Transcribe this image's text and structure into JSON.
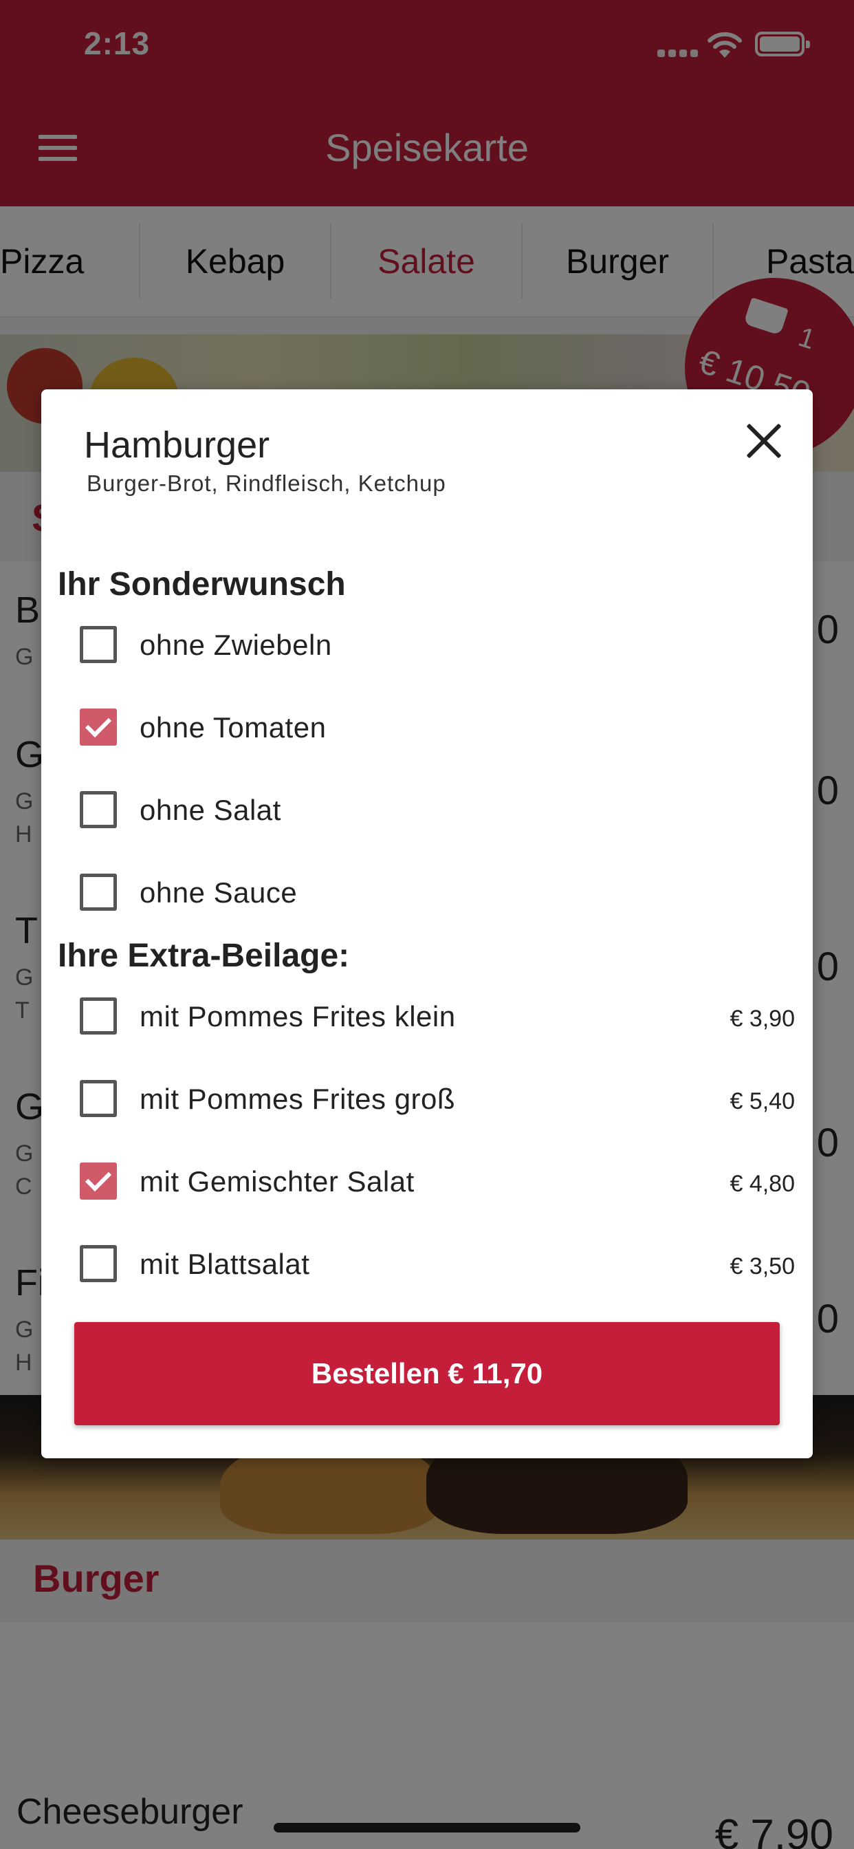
{
  "status_bar": {
    "time": "2:13"
  },
  "header": {
    "title": "Speisekarte"
  },
  "tabs": [
    {
      "label": "Pizza"
    },
    {
      "label": "Kebap"
    },
    {
      "label": "Salate",
      "active": true
    },
    {
      "label": "Burger"
    },
    {
      "label": "Pasta"
    }
  ],
  "cart": {
    "count": "1",
    "total": "€ 10,50"
  },
  "background_list": {
    "section_letter": "S",
    "items": [
      {
        "name": "B",
        "sub": "G",
        "price": "0"
      },
      {
        "name": "G",
        "sub": "G",
        "sub2": "H",
        "price": "0"
      },
      {
        "name": "T",
        "sub": "G",
        "sub2": "T",
        "price": "0"
      },
      {
        "name": "G",
        "sub": "G",
        "sub2": "C",
        "price": "0"
      },
      {
        "name": "Fi",
        "sub": "G",
        "sub2": "H",
        "price": "0"
      }
    ],
    "burger_section_title": "Burger",
    "cheese_item": {
      "name": "Cheeseburger",
      "price": "€ 7,90"
    }
  },
  "modal": {
    "title": "Hamburger",
    "subtitle": "Burger-Brot, Rindfleisch, Ketchup",
    "special_section": "Ihr Sonderwunsch",
    "special_options": [
      {
        "label": "ohne Zwiebeln",
        "checked": false
      },
      {
        "label": "ohne Tomaten",
        "checked": true
      },
      {
        "label": "ohne Salat",
        "checked": false
      },
      {
        "label": "ohne Sauce",
        "checked": false
      }
    ],
    "extra_section": "Ihre Extra-Beilage:",
    "extra_options": [
      {
        "label": "mit Pommes Frites klein",
        "price": "€ 3,90",
        "checked": false
      },
      {
        "label": "mit Pommes Frites groß",
        "price": "€ 5,40",
        "checked": false
      },
      {
        "label": "mit Gemischter Salat",
        "price": "€ 4,80",
        "checked": true
      },
      {
        "label": "mit Blattsalat",
        "price": "€ 3,50",
        "checked": false
      }
    ],
    "order_button": "Bestellen € 11,70"
  },
  "colors": {
    "brand": "#c41e3a",
    "checkbox_checked": "#d0596a"
  }
}
